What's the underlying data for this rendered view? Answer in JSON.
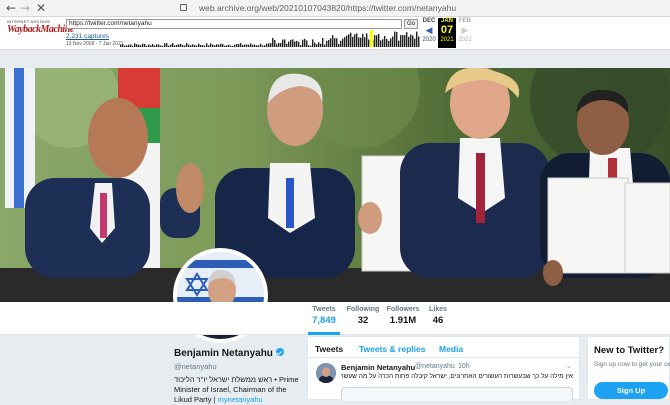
{
  "browser": {
    "back_icon": "arrow-left-icon",
    "forward_icon": "arrow-right-icon",
    "close_icon": "close-icon",
    "url": "web.archive.org/web/20210107043820/https://twitter.com/netanyahu"
  },
  "wayback": {
    "logo_top": "INTERNET ARCHIVE",
    "logo_main": "WaybackMachine",
    "url_value": "https://twitter.com/netanyahu",
    "go_label": "Go",
    "captures": "2,231 captures",
    "range": "13 Nov 2008 - 7 Jan 2021",
    "prev_month": "DEC",
    "prev_year": "2020",
    "cur_month": "JAN",
    "cur_day": "07",
    "cur_year": "2021",
    "next_month": "FEB",
    "next_year": "2022"
  },
  "profile": {
    "name": "Benjamin Netanyahu",
    "handle": "@netanyahu",
    "bio": "ראש ממשלת ישראל יו\"ר הליכוד • Prime Minister of Israel, Chairman of the Likud Party |",
    "bio_link": "mynetanyahu",
    "stats": [
      {
        "label": "Tweets",
        "value": "7,849"
      },
      {
        "label": "Following",
        "value": "32"
      },
      {
        "label": "Followers",
        "value": "1.91M"
      },
      {
        "label": "Likes",
        "value": "46"
      }
    ]
  },
  "timeline": {
    "tabs": [
      "Tweets",
      "Tweets & replies",
      "Media"
    ],
    "tweet": {
      "name": "Benjamin Netanyahu",
      "handle": "@netanyahu",
      "time": "10h",
      "text": "אין מילה על כך שבעשרות העשורים האחרונים, ישראל קיבלה פחות הכרה על מה שעשתה. אתם כבר יודעים למה."
    }
  },
  "signup": {
    "title": "New to Twitter?",
    "subtitle": "Sign up now to get your own personalized timeline!",
    "button": "Sign Up"
  },
  "colors": {
    "twitter_blue": "#1da1f2",
    "wayback_red": "#b01e1e",
    "background": "#e6ecf0"
  }
}
